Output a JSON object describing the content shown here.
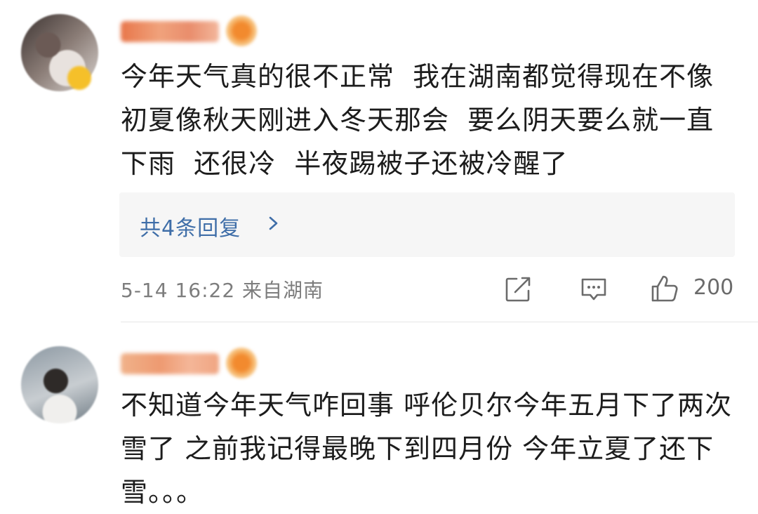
{
  "comments": [
    {
      "username": "一卡雪碧",
      "text": "今年天气真的很不正常  我在湖南都觉得现在不像初夏像秋天刚进入冬天那会  要么阴天要么就一直下雨  还很冷  半夜踢被子还被冷醒了",
      "replies_label": "共4条回复",
      "meta": "5-14 16:22  来自湖南",
      "likes": "200"
    },
    {
      "username": "蓝莓雪碧",
      "text": "不知道今年天气咋回事 呼伦贝尔今年五月下了两次雪了 之前我记得最晚下到四月份 今年立夏了还下雪。。。"
    }
  ],
  "colors": {
    "link": "#3f6ea8",
    "meta": "#7d7d7d",
    "reply_bg": "#f6f6f6"
  }
}
